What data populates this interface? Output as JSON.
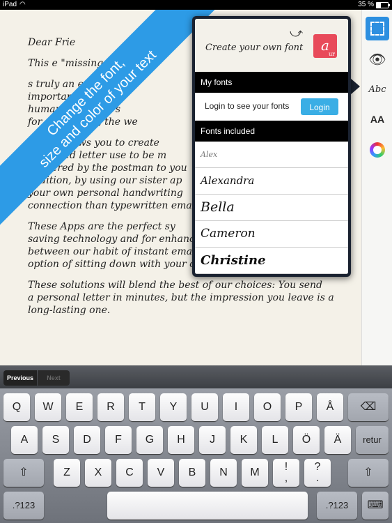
{
  "status_bar": {
    "carrier": "iPad",
    "wifi_icon": "wifi-icon",
    "time": "",
    "battery": "35 %",
    "battery_level": 0.35
  },
  "letter": {
    "greeting": "Dear Frie",
    "paragraphs": [
      "This                      e \"missing",
      "           s truly an end\n      important disapp\n      humanity of a pers\n      for a recipient, the we",
      "etters allows you to create\n fashioned letter use to be m\ndelivered by the postman to you\naddition, by using our sister ap\nyour own personal handwriting\nconnection than typewritten emai",
      "These Apps are the perfect sy\nsaving technology and for enhanc\nbetween our habit of instant emails and the more cumbersome\noption of sitting down with your own paper, pen and stamps.",
      "These solutions will blend the best of our choices: You send\na personal letter in minutes, but the impression you leave is a\nlong-lasting one."
    ]
  },
  "ribbon": {
    "line1": "Change the font,",
    "line2": "size and color of your text"
  },
  "popover": {
    "create_label": "Create your own font",
    "app_icon_letter": "a",
    "app_icon_sub": "ur",
    "my_fonts_header": "My fonts",
    "login_prompt": "Login to see your fonts",
    "login_button": "Login",
    "fonts_included_header": "Fonts included",
    "fonts": [
      "Alex",
      "Alexandra",
      "Bella",
      "Cameron",
      "Christine"
    ]
  },
  "toolbar": {
    "eye": "👁",
    "font_sample": "Abc",
    "size_sample": "AA"
  },
  "accessory": {
    "previous": "Previous",
    "next": "Next"
  },
  "keyboard": {
    "row1": [
      "Q",
      "W",
      "E",
      "R",
      "T",
      "Y",
      "U",
      "I",
      "O",
      "P",
      "Å"
    ],
    "row2": [
      "A",
      "S",
      "D",
      "F",
      "G",
      "H",
      "J",
      "K",
      "L",
      "Ö",
      "Ä"
    ],
    "row3": [
      "Z",
      "X",
      "C",
      "V",
      "B",
      "N",
      "M",
      "!\n,",
      "?\n."
    ],
    "return": "retur",
    "numbers_left": ".?123",
    "numbers_right": ".?123",
    "delete_icon": "⌫",
    "shift_icon": "⇧",
    "hide_keyboard_icon": "⌨"
  }
}
